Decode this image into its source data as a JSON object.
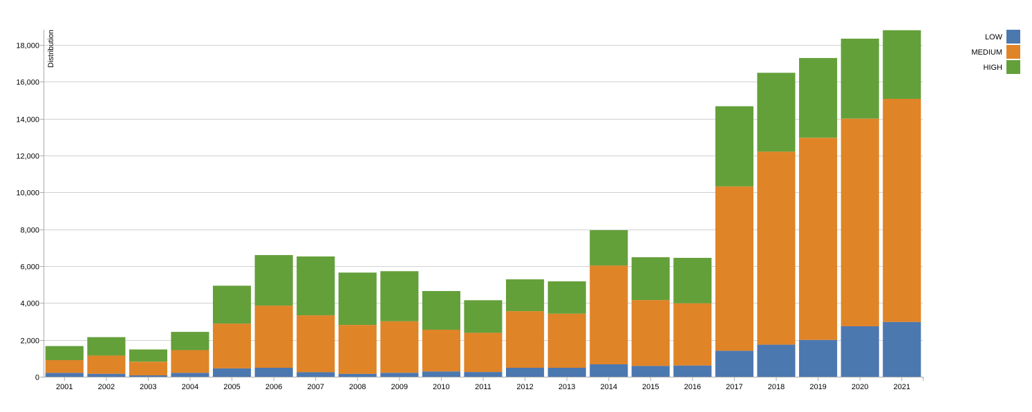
{
  "chart_data": {
    "type": "bar",
    "stacked": true,
    "title": "",
    "xlabel": "",
    "ylabel": "Distribution",
    "ylim": [
      0,
      18800
    ],
    "yticks": [
      0,
      2000,
      4000,
      6000,
      8000,
      10000,
      12000,
      14000,
      16000,
      18000
    ],
    "ytick_labels": [
      "0",
      "2,000",
      "4,000",
      "6,000",
      "8,000",
      "10,000",
      "12,000",
      "14,000",
      "16,000",
      "18,000"
    ],
    "grid": true,
    "legend_position": "top-right",
    "categories": [
      "2001",
      "2002",
      "2003",
      "2004",
      "2005",
      "2006",
      "2007",
      "2008",
      "2009",
      "2010",
      "2011",
      "2012",
      "2013",
      "2014",
      "2015",
      "2016",
      "2017",
      "2018",
      "2019",
      "2020",
      "2021"
    ],
    "series": [
      {
        "name": "LOW",
        "color": "#4c78b0",
        "values": [
          210,
          160,
          75,
          210,
          455,
          490,
          250,
          160,
          215,
          290,
          260,
          490,
          490,
          675,
          590,
          610,
          1410,
          1740,
          2000,
          2740,
          2975
        ]
      },
      {
        "name": "MEDIUM",
        "color": "#e08428",
        "values": [
          690,
          990,
          740,
          1235,
          2430,
          3370,
          3085,
          2650,
          2795,
          2260,
          2125,
          3070,
          2935,
          5360,
          3570,
          3375,
          8915,
          10475,
          10965,
          11260,
          12100
        ]
      },
      {
        "name": "HIGH",
        "color": "#64a03a",
        "values": [
          765,
          1000,
          665,
          990,
          2055,
          2740,
          3190,
          2840,
          2715,
          2100,
          1765,
          1725,
          1750,
          1915,
          2325,
          2465,
          4350,
          4275,
          4325,
          4340,
          3725
        ]
      }
    ]
  }
}
